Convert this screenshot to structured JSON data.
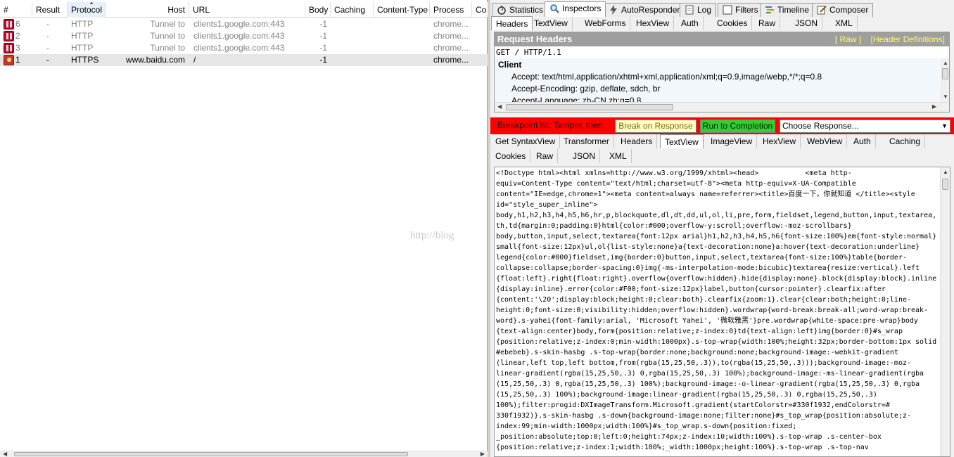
{
  "session_list": {
    "columns": [
      "#",
      "Result",
      "Protocol",
      "Host",
      "URL",
      "Body",
      "Caching",
      "Content-Type",
      "Process",
      "Co"
    ],
    "rows": [
      {
        "num": "6",
        "result": "-",
        "protocol": "HTTP",
        "host": "Tunnel to",
        "url": "clients1.google.com:443",
        "body": "-1",
        "caching": "",
        "content_type": "",
        "process": "chrome...",
        "icon": "breakpoint-icon"
      },
      {
        "num": "2",
        "result": "-",
        "protocol": "HTTP",
        "host": "Tunnel to",
        "url": "clients1.google.com:443",
        "body": "-1",
        "caching": "",
        "content_type": "",
        "process": "chrome...",
        "icon": "breakpoint-icon"
      },
      {
        "num": "3",
        "result": "-",
        "protocol": "HTTP",
        "host": "Tunnel to",
        "url": "clients1.google.com:443",
        "body": "-1",
        "caching": "",
        "content_type": "",
        "process": "chrome...",
        "icon": "breakpoint-icon"
      },
      {
        "num": "1",
        "result": "-",
        "protocol": "HTTPS",
        "host": "www.baidu.com",
        "url": "/",
        "body": "-1",
        "caching": "",
        "content_type": "",
        "process": "chrome...",
        "icon": "breakpoint-response-icon"
      }
    ]
  },
  "watermark": "http://blog",
  "main_tabs": [
    "Statistics",
    "Inspectors",
    "AutoResponder",
    "Log",
    "Filters",
    "Timeline",
    "Composer"
  ],
  "request_tabs": [
    "Headers",
    "TextView",
    "WebForms",
    "HexView",
    "Auth",
    "Cookies",
    "Raw",
    "JSON",
    "XML"
  ],
  "request": {
    "title": "Request Headers",
    "raw_link": "[ Raw ]",
    "defs_link": "[Header Definitions]",
    "request_line": "GET / HTTP/1.1",
    "group": "Client",
    "headers": [
      "Accept: text/html,application/xhtml+xml,application/xml;q=0.9,image/webp,*/*;q=0.8",
      "Accept-Encoding: gzip, deflate, sdch, br",
      "Accept-Language: zh-CN,zh;q=0.8"
    ]
  },
  "breakpoint": {
    "label": "Breakpoint hit. Tamper, then:",
    "break_on_response": "Break on Response",
    "run_to_completion": "Run to Completion",
    "choose_response": "Choose Response...",
    "colors": {
      "bar": "#ff0000",
      "break_btn": "#ffffc8",
      "run_btn": "#33cc33"
    }
  },
  "response_tabs_row1": [
    "Get SyntaxView",
    "Transformer",
    "Headers",
    "TextView",
    "ImageView",
    "HexView",
    "WebView",
    "Auth",
    "Caching"
  ],
  "response_tabs_row2": [
    "Cookies",
    "Raw",
    "JSON",
    "XML"
  ],
  "response_text": "<!Doctype html><html xmlns=http://www.w3.org/1999/xhtml><head>           <meta http-\nequiv=Content-Type content=\"text/html;charset=utf-8\"><meta http-equiv=X-UA-Compatible\ncontent=\"IE=edge,chrome=1\"><meta content=always name=referrer><title>百度一下，你就知道 </title><style\nid=\"style_super_inline\">\nbody,h1,h2,h3,h4,h5,h6,hr,p,blockquote,dl,dt,dd,ul,ol,li,pre,form,fieldset,legend,button,input,textarea,\nth,td{margin:0;padding:0}html{color:#000;overflow-y:scroll;overflow:-moz-scrollbars}\nbody,button,input,select,textarea{font:12px arial}h1,h2,h3,h4,h5,h6{font-size:100%}em{font-style:normal}\nsmall{font-size:12px}ul,ol{list-style:none}a{text-decoration:none}a:hover{text-decoration:underline}\nlegend{color:#000}fieldset,img{border:0}button,input,select,textarea{font-size:100%}table{border-\ncollapse:collapse;border-spacing:0}img{-ms-interpolation-mode:bicubic}textarea{resize:vertical}.left\n{float:left}.right{float:right}.overflow{overflow:hidden}.hide{display:none}.block{display:block}.inline\n{display:inline}.error{color:#F00;font-size:12px}label,button{cursor:pointer}.clearfix:after\n{content:'\\20';display:block;height:0;clear:both}.clearfix{zoom:1}.clear{clear:both;height:0;line-\nheight:0;font-size:0;visibility:hidden;overflow:hidden}.wordwrap{word-break:break-all;word-wrap:break-\nword}.s-yahei{font-family:arial, 'Microsoft Yahei', '微软雅黑'}pre.wordwrap{white-space:pre-wrap}body\n{text-align:center}body,form{position:relative;z-index:0}td{text-align:left}img{border:0}#s_wrap\n{position:relative;z-index:0;min-width:1000px}.s-top-wrap{width:100%;height:32px;border-bottom:1px solid\n#ebebeb}.s-skin-hasbg .s-top-wrap{border:none;background:none;background-image:-webkit-gradient\n(linear,left top,left bottom,from(rgba(15,25,50,.3)),to(rgba(15,25,50,.3)));background-image:-moz-\nlinear-gradient(rgba(15,25,50,.3) 0,rgba(15,25,50,.3) 100%);background-image:-ms-linear-gradient(rgba\n(15,25,50,.3) 0,rgba(15,25,50,.3) 100%);background-image:-o-linear-gradient(rgba(15,25,50,.3) 0,rgba\n(15,25,50,.3) 100%);background-image:linear-gradient(rgba(15,25,50,.3) 0,rgba(15,25,50,.3)\n100%);filter:progid:DXImageTransform.Microsoft.gradient(startColorstr=#330f1932,endColorstr=#\n330f1932)}.s-skin-hasbg .s-down{background-image:none;filter:none}#s_top_wrap{position:absolute;z-\nindex:99;min-width:1000px;width:100%}#s_top_wrap.s-down{position:fixed;\n_position:absolute;top:0;left:0;height:74px;z-index:10;width:100%}.s-top-wrap .s-center-box\n{position:relative;z-index:1;width:100%;_width:1000px;height:100%}.s-top-wrap .s-top-nav"
}
